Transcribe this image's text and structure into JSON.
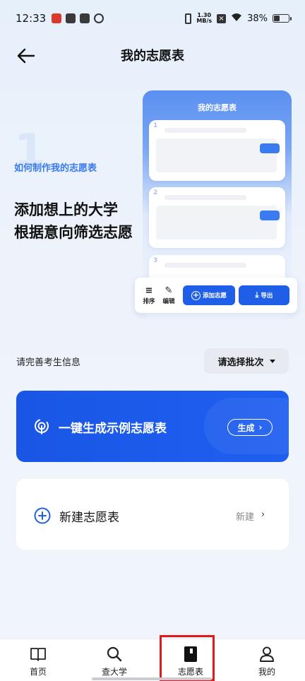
{
  "status": {
    "time": "12:33",
    "speed_top": "1.30",
    "speed_bottom": "MB/s",
    "battery": "38%"
  },
  "header": {
    "title": "我的志愿表"
  },
  "howto": {
    "step_number": "1",
    "label": "如何制作我的志愿表",
    "line1": "添加想上的大学",
    "line2": "根据意向筛选志愿"
  },
  "preview": {
    "title": "我的志愿表",
    "cards": [
      "1",
      "2",
      "3"
    ],
    "toolbar": {
      "sort": "排序",
      "edit": "编辑",
      "add": "添加志愿",
      "export": "导出"
    }
  },
  "info": {
    "prompt": "请完善考生信息",
    "batch_select": "请选择批次"
  },
  "generate": {
    "title": "一键生成示例志愿表",
    "button": "生成"
  },
  "create": {
    "title": "新建志愿表",
    "link": "新建"
  },
  "tabs": [
    {
      "label": "首页",
      "icon": "book-open-icon"
    },
    {
      "label": "查大学",
      "icon": "search-icon"
    },
    {
      "label": "志愿表",
      "icon": "bookmark-book-icon"
    },
    {
      "label": "我的",
      "icon": "person-icon"
    }
  ],
  "colors": {
    "accent": "#1f5fe8",
    "highlight": "#e01a1a"
  }
}
